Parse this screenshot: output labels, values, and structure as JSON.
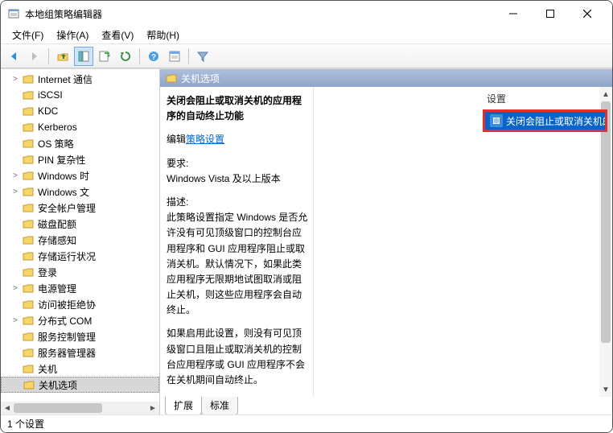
{
  "window": {
    "title": "本地组策略编辑器"
  },
  "menu": {
    "file": "文件(F)",
    "action": "操作(A)",
    "view": "查看(V)",
    "help": "帮助(H)"
  },
  "tree": {
    "items": [
      {
        "label": "Internet 通信",
        "expander": ">"
      },
      {
        "label": "iSCSI",
        "expander": ""
      },
      {
        "label": "KDC",
        "expander": ""
      },
      {
        "label": "Kerberos",
        "expander": ""
      },
      {
        "label": "OS 策略",
        "expander": ""
      },
      {
        "label": "PIN 复杂性",
        "expander": ""
      },
      {
        "label": "Windows 时",
        "expander": ">"
      },
      {
        "label": "Windows 文",
        "expander": ">"
      },
      {
        "label": "安全帐户管理",
        "expander": ""
      },
      {
        "label": "磁盘配额",
        "expander": ""
      },
      {
        "label": "存储感知",
        "expander": ""
      },
      {
        "label": "存储运行状况",
        "expander": ""
      },
      {
        "label": "登录",
        "expander": ""
      },
      {
        "label": "电源管理",
        "expander": ">"
      },
      {
        "label": "访问被拒绝协",
        "expander": ""
      },
      {
        "label": "分布式 COM",
        "expander": ">"
      },
      {
        "label": "服务控制管理",
        "expander": ""
      },
      {
        "label": "服务器管理器",
        "expander": ""
      },
      {
        "label": "关机",
        "expander": ""
      },
      {
        "label": "关机选项",
        "expander": "",
        "selected": true
      }
    ]
  },
  "pane": {
    "header": "关机选项",
    "policy_title": "关闭会阻止或取消关机的应用程序的自动终止功能",
    "edit_prefix": "编辑",
    "edit_link": "策略设置",
    "req_label": "要求:",
    "req_value": "Windows Vista 及以上版本",
    "desc_label": "描述:",
    "desc_p1": "此策略设置指定 Windows 是否允许没有可见顶级窗口的控制台应用程序和 GUI 应用程序阻止或取消关机。默认情况下，如果此类应用程序无限期地试图取消或阻止关机，则这些应用程序会自动终止。",
    "desc_p2": "如果启用此设置，则没有可见顶级窗口且阻止或取消关机的控制台应用程序或 GUI 应用程序不会在关机期间自动终止。",
    "settings_header": "设置",
    "setting_item": "关闭会阻止或取消关机的应用程序的自动终止功能"
  },
  "tabs": {
    "extended": "扩展",
    "standard": "标准"
  },
  "status": {
    "text": "1 个设置"
  }
}
